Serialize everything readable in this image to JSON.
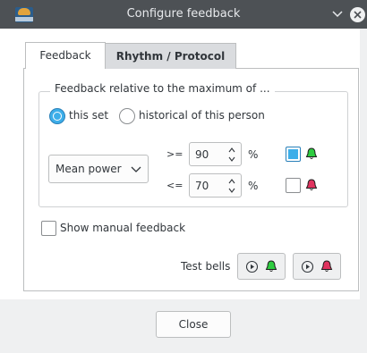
{
  "window": {
    "title": "Configure feedback",
    "app_icon": "chronojump-logo"
  },
  "tabs": [
    {
      "label": "Feedback",
      "active": true
    },
    {
      "label": "Rhythm / Protocol",
      "active": false
    }
  ],
  "feedback": {
    "group_title": "Feedback relative to the maximum of ...",
    "relative_options": [
      {
        "label": "this set",
        "selected": true
      },
      {
        "label": "historical of this person",
        "selected": false
      }
    ],
    "variable": {
      "selected": "Mean power"
    },
    "upper": {
      "comparator": ">=",
      "value": "90",
      "unit": "%",
      "enabled": true,
      "bell": "green-bell-icon"
    },
    "lower": {
      "comparator": "<=",
      "value": "70",
      "unit": "%",
      "enabled": false,
      "bell": "red-bell-icon"
    },
    "show_manual": {
      "label": "Show manual feedback",
      "checked": false
    },
    "test_bells": {
      "label": "Test bells"
    }
  },
  "footer": {
    "close_label": "Close"
  },
  "colors": {
    "titlebar": "#4d5155",
    "accent": "#3daee9",
    "bell_good": "#2ecc40",
    "bell_bad": "#e0335f"
  }
}
